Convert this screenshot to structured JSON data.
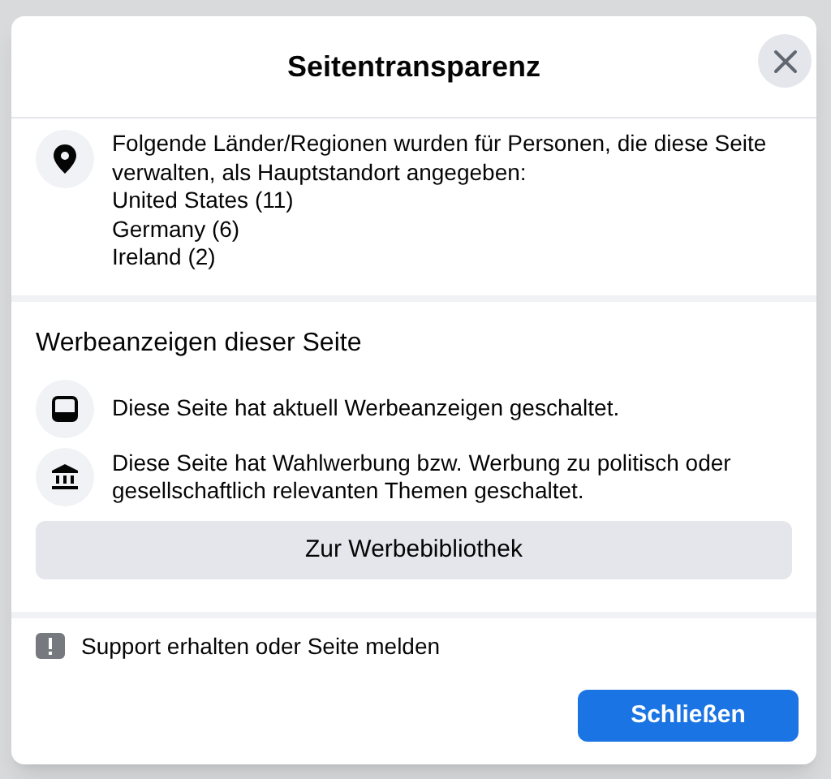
{
  "dialog": {
    "title": "Seitentransparenz",
    "location": {
      "text": "Folgende Länder/Regionen wurden für Personen, die diese Seite verwalten, als Hauptstandort angegeben:",
      "countries": [
        "United States (11)",
        "Germany (6)",
        "Ireland (2)"
      ]
    },
    "ads": {
      "heading": "Werbeanzeigen dieser Seite",
      "items": [
        {
          "kind": "ads",
          "text": "Diese Seite hat aktuell Werbeanzeigen geschaltet."
        },
        {
          "kind": "political",
          "text": "Diese Seite hat Wahlwerbung bzw. Werbung zu politisch oder gesellschaftlich relevanten Themen geschaltet."
        }
      ],
      "library_button": "Zur Werbebibliothek"
    },
    "support_link": "Support erhalten oder Seite melden",
    "close_button": "Schließen"
  }
}
